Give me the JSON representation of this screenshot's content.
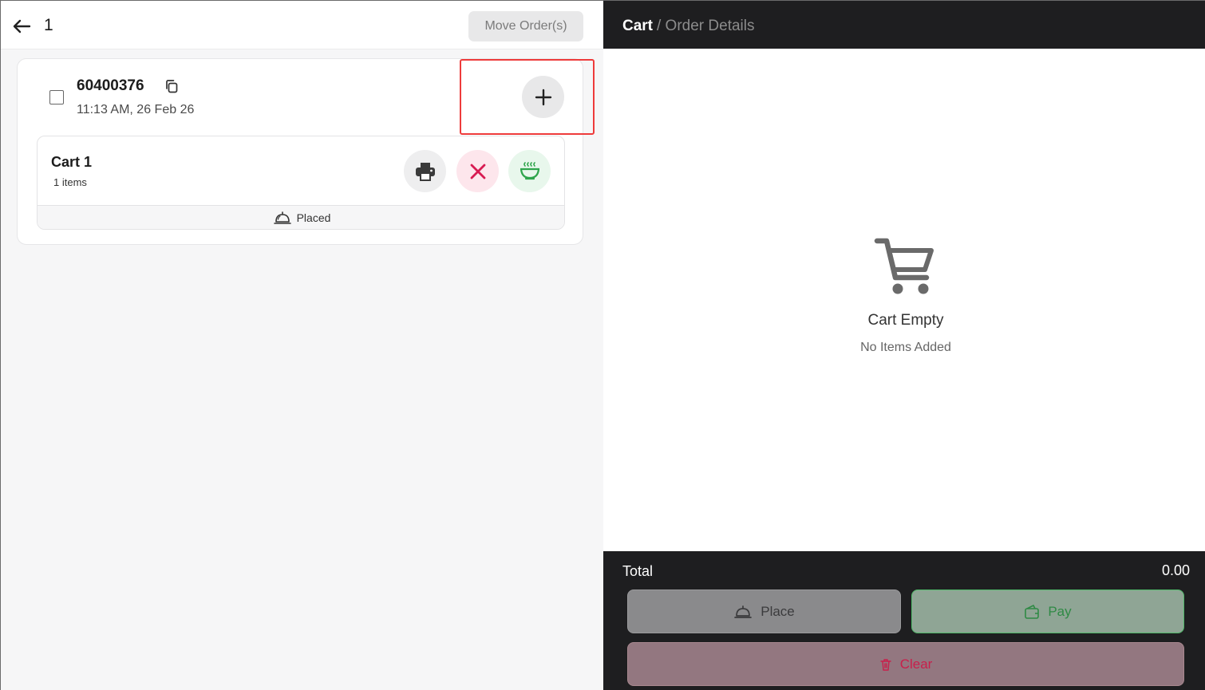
{
  "header": {
    "title": "1",
    "move_button": "Move Order(s)"
  },
  "order": {
    "id": "60400376",
    "time": "11:13 AM, 26 Feb 26",
    "cart": {
      "name": "Cart 1",
      "items": "1 items",
      "status": "Placed"
    }
  },
  "right": {
    "breadcrumb_cart": "Cart",
    "breadcrumb_details": "/ Order Details",
    "empty_title": "Cart Empty",
    "empty_sub": "No Items Added",
    "total_label": "Total",
    "total_value": "0.00",
    "buttons": {
      "place": "Place",
      "pay": "Pay",
      "clear": "Clear"
    }
  },
  "colors": {
    "dark_bar": "#1e1e20",
    "highlight": "#ee3b3b",
    "green": "#2f8a45",
    "red": "#c91f4b"
  },
  "icons": [
    "back-arrow-icon",
    "copy-icon",
    "plus-icon",
    "printer-icon",
    "close-icon",
    "serve-bowl-icon",
    "service-bell-icon",
    "cart-icon",
    "wallet-icon",
    "trash-icon"
  ]
}
